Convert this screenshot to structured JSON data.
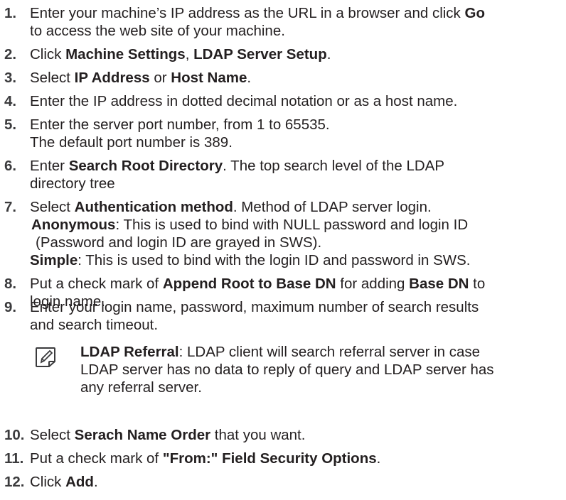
{
  "steps": [
    {
      "num": "1.",
      "lines": [
        [
          {
            "t": "Enter your machine’s IP address as the URL in a browser and click "
          },
          {
            "t": "Go",
            "b": true
          }
        ],
        [
          {
            "t": "to access the web site of your machine."
          }
        ]
      ]
    },
    {
      "num": "2.",
      "lines": [
        [
          {
            "t": "Click "
          },
          {
            "t": "Machine Settings",
            "b": true
          },
          {
            "t": ", "
          },
          {
            "t": "LDAP Server Setup",
            "b": true
          },
          {
            "t": "."
          }
        ]
      ]
    },
    {
      "num": "3.",
      "lines": [
        [
          {
            "t": "Select "
          },
          {
            "t": "IP Address",
            "b": true
          },
          {
            "t": " or "
          },
          {
            "t": "Host Name",
            "b": true
          },
          {
            "t": "."
          }
        ]
      ]
    },
    {
      "num": "4.",
      "lines": [
        [
          {
            "t": "Enter the IP address in dotted decimal notation or as a host name."
          }
        ]
      ]
    },
    {
      "num": "5.",
      "lines": [
        [
          {
            "t": "Enter the server port number, from 1 to 65535."
          }
        ],
        [
          {
            "t": "The default port number is 389."
          }
        ]
      ]
    },
    {
      "num": "6.",
      "lines": [
        [
          {
            "t": "Enter "
          },
          {
            "t": "Search Root Directory",
            "b": true
          },
          {
            "t": ". The top search level of the LDAP"
          }
        ],
        [
          {
            "t": "directory tree"
          }
        ]
      ]
    },
    {
      "num": "7.",
      "lines": [
        [
          {
            "t": "Select "
          },
          {
            "t": "Authentication method",
            "b": true
          },
          {
            "t": ". Method of LDAP server login."
          }
        ],
        [
          {
            "t": "Anonymous",
            "b": true
          },
          {
            "t": ": This is used to bind with NULL password and login ID"
          }
        ],
        [
          {
            "t": "(Password and login ID are grayed in SWS)."
          }
        ],
        [
          {
            "t": "Simple",
            "b": true
          },
          {
            "t": ": This is used to bind with the login ID and password in SWS."
          }
        ]
      ]
    },
    {
      "num": "8.",
      "lines": [
        [
          {
            "t": "Put a check mark of "
          },
          {
            "t": "Append Root to Base DN",
            "b": true
          },
          {
            "t": " for adding "
          },
          {
            "t": "Base DN",
            "b": true
          },
          {
            "t": " to"
          }
        ],
        [
          {
            "t": "login name."
          }
        ]
      ]
    },
    {
      "num": "9.",
      "lines": [
        [
          {
            "t": "Enter your login name, password, maximum number of search results"
          }
        ],
        [
          {
            "t": "and search timeout."
          }
        ]
      ]
    },
    {
      "num": "10.",
      "lines": [
        [
          {
            "t": "Select "
          },
          {
            "t": "Serach Name Order",
            "b": true
          },
          {
            "t": " that you want."
          }
        ]
      ]
    },
    {
      "num": "11.",
      "lines": [
        [
          {
            "t": "Put a check mark of "
          },
          {
            "t": "\"From:\" Field Security Options",
            "b": true
          },
          {
            "t": "."
          }
        ]
      ]
    },
    {
      "num": "12.",
      "lines": [
        [
          {
            "t": "Click "
          },
          {
            "t": "Add",
            "b": true
          },
          {
            "t": "."
          }
        ]
      ]
    }
  ],
  "note": {
    "icon": "note-pencil-icon",
    "lines": [
      [
        {
          "t": "LDAP Referral",
          "b": true
        },
        {
          "t": ": LDAP client will search referral server in case"
        }
      ],
      [
        {
          "t": "LDAP server has no data to reply of query and LDAP server has"
        }
      ],
      [
        {
          "t": "any referral server."
        }
      ]
    ]
  }
}
